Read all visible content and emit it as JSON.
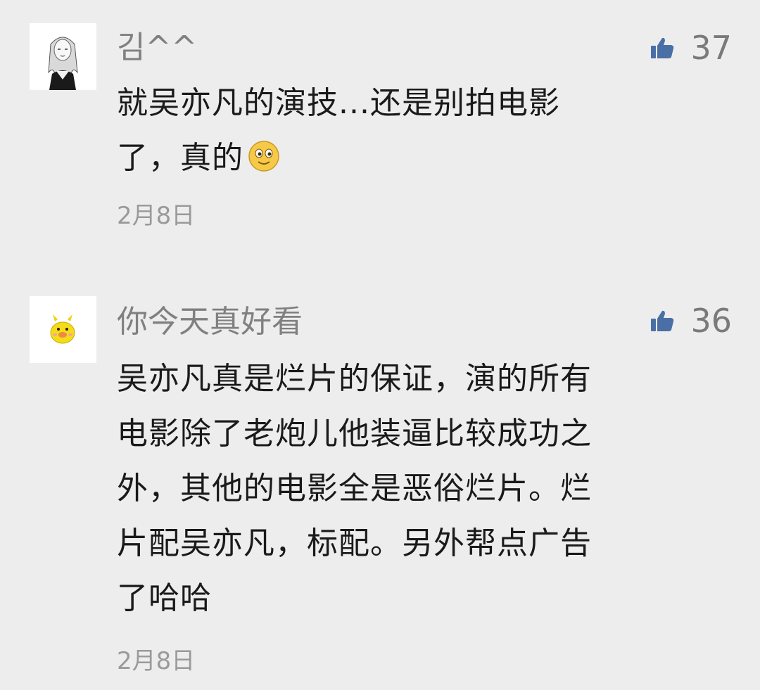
{
  "comments": [
    {
      "username": "김^^",
      "avatar_icon": "avatar-girl-sketch",
      "like_icon": "thumbs-up-icon",
      "like_count": "37",
      "content_lines": [
        "就吴亦凡的演技...还是别拍电影",
        "了，真的"
      ],
      "emoji_icon": "smile-emoji-icon",
      "date": "2月8日"
    },
    {
      "username": "你今天真好看",
      "avatar_icon": "avatar-yellow-duck",
      "like_icon": "thumbs-up-icon",
      "like_count": "36",
      "content_lines": [
        "吴亦凡真是烂片的保证，演的所有",
        "电影除了老炮儿他装逼比较成功之",
        "外，其他的电影全是恶俗烂片。烂",
        "片配吴亦凡，标配。另外帮点广告",
        "了哈哈"
      ],
      "date": "2月8日"
    }
  ],
  "colors": {
    "background": "#ededed",
    "like_icon": "#4a6fa5",
    "username": "#808080",
    "date": "#9a9a9a"
  }
}
